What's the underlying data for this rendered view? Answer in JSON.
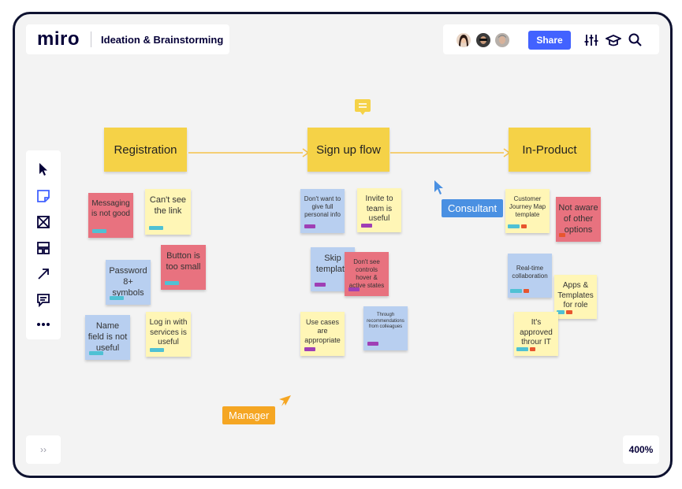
{
  "app": {
    "logo": "miro",
    "board_title": "Ideation & Brainstorming"
  },
  "header": {
    "share_label": "Share",
    "zoom": "400%",
    "collapse_label": "››"
  },
  "colors": {
    "brand": "#4262ff",
    "frame": "#f5d247",
    "manager": "#f5a623",
    "consultant": "#4a90e2"
  },
  "frames": [
    {
      "label": "Registration"
    },
    {
      "label": "Sign up flow"
    },
    {
      "label": "In-Product"
    }
  ],
  "notes": {
    "n1": "Messaging is not good",
    "n2": "Can't see the link",
    "n3": "Button is too small",
    "n4": "Password 8+ symbols",
    "n5": "Name field is not useful",
    "n6": "Log in with services is useful",
    "n7": "Don't want to give full personal info",
    "n8": "Invite to team is useful",
    "n9": "Skip template",
    "n10": "Don't see controls hover & active states",
    "n11": "Use cases are appropriate",
    "n12": "Through recommendations from colleagues",
    "n13": "Customer Journey Map template",
    "n14": "Not aware of other options",
    "n15": "Real-time collaboration",
    "n16": "Apps & Templates for role",
    "n17": "It's approved throur IT"
  },
  "cursors": {
    "manager": "Manager",
    "consultant": "Consultant"
  },
  "toolbar_icons": [
    "cursor-icon",
    "sticky-note-icon",
    "frame-icon",
    "templates-icon",
    "arrow-icon",
    "comment-icon",
    "more-icon"
  ]
}
